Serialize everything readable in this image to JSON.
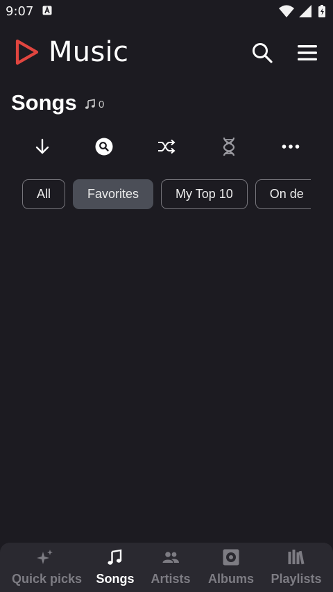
{
  "status_bar": {
    "time": "9:07",
    "icons": [
      "text-notification-icon",
      "wifi-icon",
      "signal-icon",
      "battery-icon"
    ]
  },
  "app_bar": {
    "title": "Music",
    "logo_icon": "play-outline-icon",
    "actions": [
      "search-icon",
      "menu-icon"
    ]
  },
  "header": {
    "title": "Songs",
    "count": "0",
    "count_icon": "music-note-icon"
  },
  "actions": [
    "download-icon",
    "search-circle-icon",
    "shuffle-icon",
    "dna-icon",
    "more-horizontal-icon"
  ],
  "chips": [
    {
      "label": "All",
      "selected": false
    },
    {
      "label": "Favorites",
      "selected": true
    },
    {
      "label": "My Top 10",
      "selected": false
    },
    {
      "label": "On de",
      "selected": false
    }
  ],
  "bottom_nav": {
    "items": [
      {
        "label": "Quick picks",
        "icon": "sparkle-icon",
        "active": false
      },
      {
        "label": "Songs",
        "icon": "music-note-icon",
        "active": true
      },
      {
        "label": "Artists",
        "icon": "people-icon",
        "active": false
      },
      {
        "label": "Albums",
        "icon": "album-icon",
        "active": false
      },
      {
        "label": "Playlists",
        "icon": "library-icon",
        "active": false
      }
    ]
  },
  "colors": {
    "background": "#1c1b21",
    "accent": "#e0453f",
    "chip_selected": "#4b4e57",
    "nav_background": "#2a2930",
    "inactive": "#7d7c83"
  }
}
